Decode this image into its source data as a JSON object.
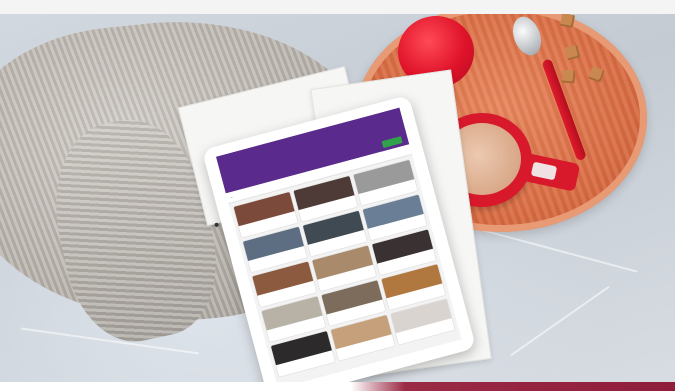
{
  "scene": {
    "description_objects": [
      "grey-knit-sweater",
      "bedsheet",
      "wooden-tray",
      "red-candle",
      "red-mug",
      "spoon",
      "sugar-cubes",
      "papers",
      "tablet"
    ]
  },
  "tablet_app": {
    "header_color": "#5a2a8c",
    "header_button_label": "",
    "subbar_title": "",
    "cards": [
      {
        "thumb": "#7b4a3a",
        "title": "",
        "meta": ""
      },
      {
        "thumb": "#4e3a36",
        "title": "",
        "meta": ""
      },
      {
        "thumb": "#9a9a9a",
        "title": "",
        "meta": ""
      },
      {
        "thumb": "#5d6d82",
        "title": "",
        "meta": ""
      },
      {
        "thumb": "#3f4a52",
        "title": "",
        "meta": ""
      },
      {
        "thumb": "#6a7f95",
        "title": "",
        "meta": ""
      },
      {
        "thumb": "#8c5a3f",
        "title": "",
        "meta": ""
      },
      {
        "thumb": "#a98a6b",
        "title": "",
        "meta": ""
      },
      {
        "thumb": "#3a3232",
        "title": "",
        "meta": ""
      },
      {
        "thumb": "#b8b2a6",
        "title": "",
        "meta": ""
      },
      {
        "thumb": "#7d6b5b",
        "title": "",
        "meta": ""
      },
      {
        "thumb": "#b0783f",
        "title": "",
        "meta": ""
      },
      {
        "thumb": "#2c2a2a",
        "title": "",
        "meta": ""
      },
      {
        "thumb": "#c6a07a",
        "title": "",
        "meta": ""
      },
      {
        "thumb": "#d9d4cf",
        "title": "",
        "meta": ""
      }
    ]
  },
  "colors": {
    "tray": "#d96c43",
    "mug": "#d8192c",
    "bottom_strip": "#8f1d3c"
  }
}
